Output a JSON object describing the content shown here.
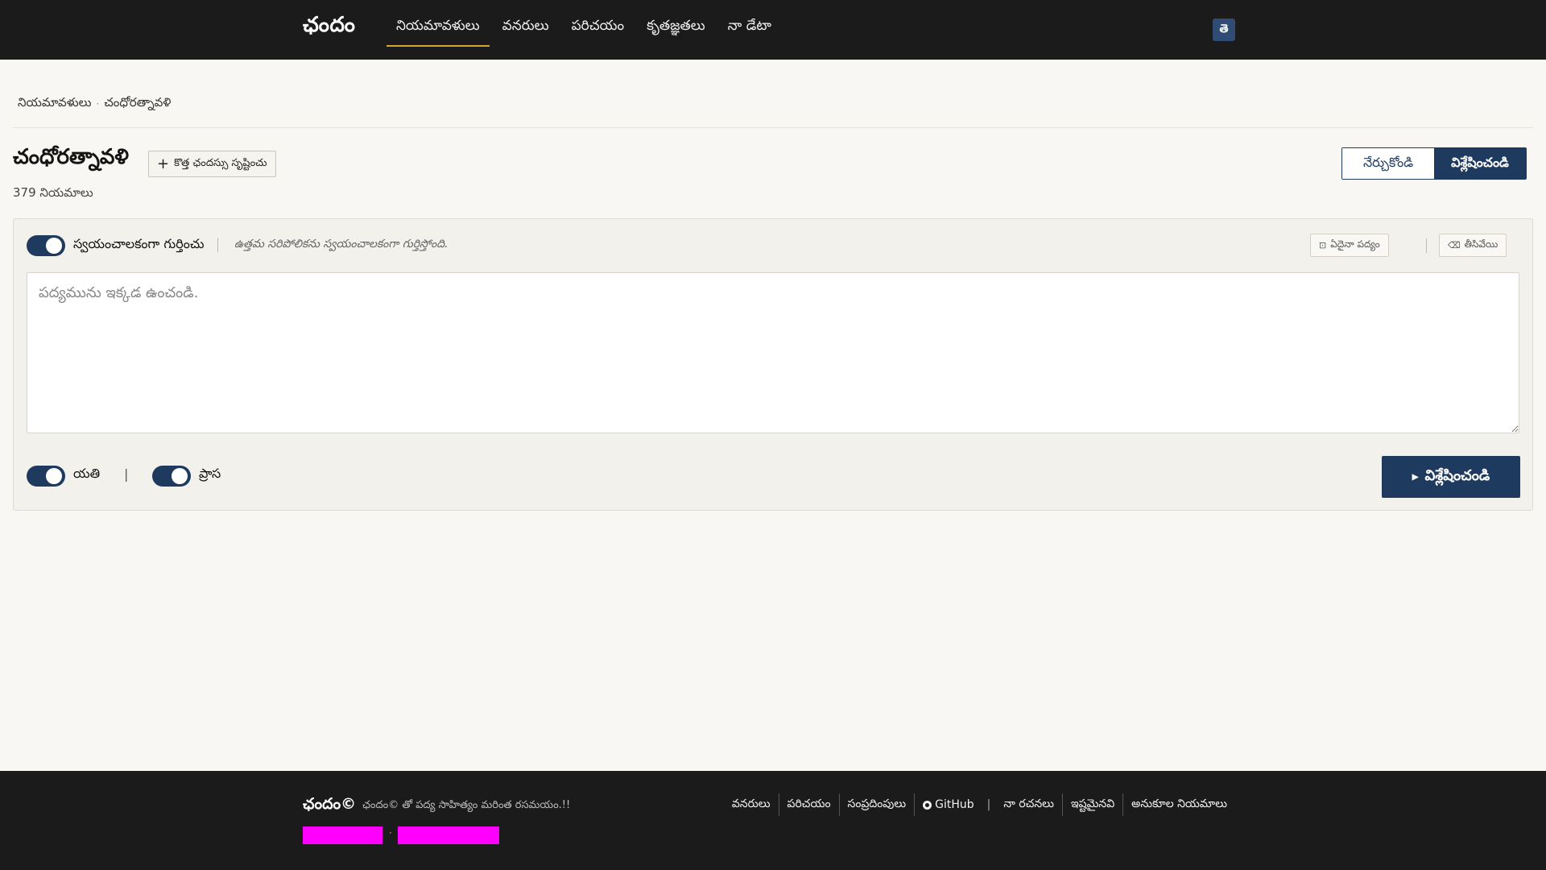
{
  "header": {
    "brand": "ఛందం",
    "nav": [
      {
        "label": "నియమావళులు",
        "active": true
      },
      {
        "label": "వనరులు"
      },
      {
        "label": "పరిచయం"
      },
      {
        "label": "కృతజ్ఞతలు"
      },
      {
        "label": "నా డేటా"
      }
    ],
    "lang_button": "తె"
  },
  "breadcrumb": {
    "root": "నియమావళులు",
    "current": "చంధోరత్నావళి"
  },
  "page": {
    "title": "చంధోరత్నావళి",
    "new_rule_label": "కొత్త ఛందస్సు సృష్టించు",
    "rule_count": "379 నియమాలు",
    "mode_learn": "నేర్చుకోండి",
    "mode_analyze": "విశ్లేషించండి"
  },
  "panel": {
    "auto_detect_label": "స్వయంచాలకంగా గుర్తించు",
    "auto_detect_hint": "ఉత్తమ సరిపోలికను స్వయంచాలకంగా గుర్తిస్తోంది.",
    "random_poem_label": "ఏదైనా పద్యం",
    "clear_label": "తీసివేయి",
    "poem_placeholder": "పద్యమును ఇక్కడ ఉంచండి.",
    "yati_label": "యతి",
    "prasa_label": "ప్రాస",
    "analyze_button": "విశ్లేషించండి"
  },
  "footer": {
    "brand": "ఛందం©",
    "tagline": "ఛందం© తో పద్య సాహిత్యం మరింత రసమయం.!!",
    "links": [
      "వనరులు",
      "పరిచయం",
      "సంప్రదింపులు",
      "GitHub",
      "నా రచనలు",
      "ఇష్టమైనవి",
      "అనుకూల నియమాలు"
    ]
  },
  "colors": {
    "primary": "#1f3a5f",
    "header_bg": "#1b1b1b",
    "accent": "#d6a53c",
    "page_bg": "#f9f7f3",
    "placeholder_blocks": "#ff00ff"
  }
}
